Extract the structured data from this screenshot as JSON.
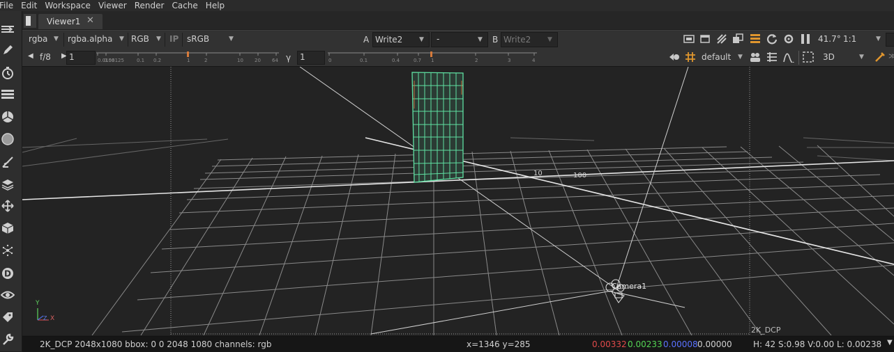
{
  "menu": [
    "File",
    "Edit",
    "Workspace",
    "Viewer",
    "Render",
    "Cache",
    "Help"
  ],
  "tab": {
    "label": "Viewer1",
    "close": "✕"
  },
  "toolbar": {
    "channels": "rgba",
    "alpha": "rgba.alpha",
    "display": "RGB",
    "ip": "IP",
    "lut": "sRGB",
    "a_label": "A",
    "a_input": "Write2",
    "wipe": "-",
    "b_label": "B",
    "b_input": "Write2",
    "zoom": "41.7°",
    "ratio": "1:1",
    "fstop": "f/8",
    "frame": "1",
    "gamma_label": "γ",
    "gamma_value": "1",
    "default_mode": "default",
    "view_mode": "3D",
    "gain_ticks": [
      "0.0156",
      "0.03125",
      "0.1",
      "0.2",
      "1",
      "2",
      "10",
      "20",
      "64"
    ],
    "gamma_ticks": [
      "0",
      "0.1",
      "0.4",
      "0.7",
      "1",
      "2",
      "3",
      "4"
    ]
  },
  "viewport": {
    "format_label": "2K_DCP",
    "camera_label": "Camera1",
    "grid_label_10": "10",
    "grid_label_100": "100",
    "axis_x": "X",
    "axis_y": "Y",
    "axis_z": "Z"
  },
  "status": {
    "info": "2K_DCP 2048x1080  bbox: 0 0 2048 1080 channels: rgb",
    "coords": "x=1346 y=285",
    "r": "0.00332",
    "g": "0.00233",
    "b": "0.00008",
    "a": "0.00000",
    "hsv": "H: 42 S:0.98 V:0.00  L: 0.00238",
    "colors": {
      "r": "#e04a4a",
      "g": "#54d454",
      "b": "#5a72ff",
      "a": "#d0d0d0"
    }
  },
  "icons": [
    "menu-collapse-icon",
    "paint-icon",
    "time-icon",
    "channel-icon",
    "color-icon",
    "filter-icon",
    "keyer-icon",
    "merge-icon",
    "transform-icon",
    "3d-icon",
    "particles-icon",
    "deep-icon",
    "views-icon",
    "metadata-icon",
    "toolsets-icon"
  ]
}
